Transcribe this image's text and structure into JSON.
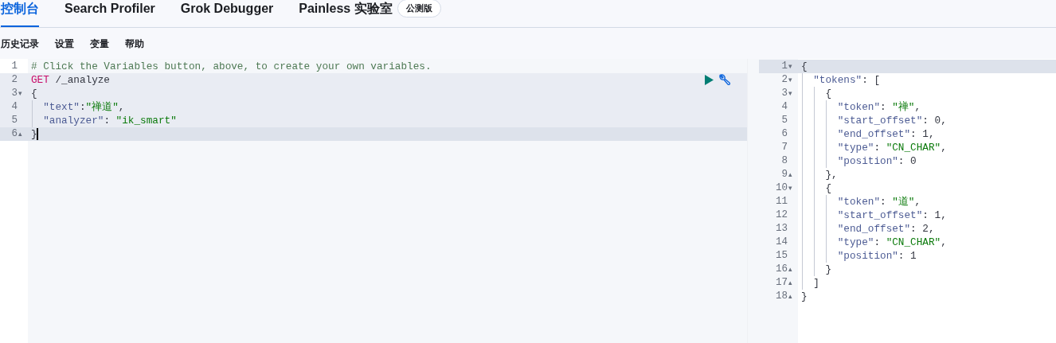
{
  "tabs": [
    {
      "label": "控制台",
      "selected": true
    },
    {
      "label": "Search Profiler",
      "selected": false
    },
    {
      "label": "Grok Debugger",
      "selected": false
    },
    {
      "label": "Painless 实验室",
      "selected": false,
      "badge": "公测版"
    }
  ],
  "toolbar": [
    "历史记录",
    "设置",
    "变量",
    "帮助"
  ],
  "request_editor": {
    "lines": [
      {
        "number": "1",
        "highlighted": false,
        "active": false,
        "segments": [
          {
            "kind": "comment",
            "text": "# Click the Variables button, above, to create your own variables."
          }
        ]
      },
      {
        "number": "2",
        "highlighted": true,
        "active": false,
        "segments": [
          {
            "kind": "method",
            "text": "GET"
          },
          {
            "kind": "plain",
            "text": " /_analyze"
          }
        ]
      },
      {
        "number": "3",
        "fold_marker": "▾",
        "highlighted": true,
        "active": false,
        "segments": [
          {
            "kind": "punct",
            "text": "{"
          }
        ]
      },
      {
        "number": "4",
        "highlighted": true,
        "active": false,
        "segments": [
          {
            "kind": "key",
            "text": "\"text\""
          },
          {
            "kind": "punct",
            "text": ":"
          },
          {
            "kind": "string",
            "text": "\"禅道\""
          },
          {
            "kind": "punct",
            "text": ","
          }
        ]
      },
      {
        "number": "5",
        "highlighted": true,
        "active": false,
        "segments": [
          {
            "kind": "key",
            "text": "\"analyzer\""
          },
          {
            "kind": "punct",
            "text": ": "
          },
          {
            "kind": "string",
            "text": "\"ik_smart\""
          }
        ]
      },
      {
        "number": "6",
        "fold_marker": "▴",
        "highlighted": true,
        "active": true,
        "segments": [
          {
            "kind": "punct",
            "text": "}"
          }
        ]
      }
    ]
  },
  "response_editor": {
    "lines": [
      {
        "number": "1",
        "fold_marker": "▾",
        "active": true,
        "segments": [
          {
            "kind": "punct",
            "text": "{"
          }
        ]
      },
      {
        "number": "2",
        "fold_marker": "▾",
        "active": false,
        "segments": [
          {
            "kind": "key",
            "text": "\"tokens\""
          },
          {
            "kind": "punct",
            "text": ": ["
          }
        ]
      },
      {
        "number": "3",
        "fold_marker": "▾",
        "active": false,
        "segments": [
          {
            "kind": "punct",
            "text": "{"
          }
        ]
      },
      {
        "number": "4",
        "active": false,
        "segments": [
          {
            "kind": "key",
            "text": "\"token\""
          },
          {
            "kind": "punct",
            "text": ": "
          },
          {
            "kind": "string",
            "text": "\"禅\""
          },
          {
            "kind": "punct",
            "text": ","
          }
        ]
      },
      {
        "number": "5",
        "active": false,
        "segments": [
          {
            "kind": "key",
            "text": "\"start_offset\""
          },
          {
            "kind": "punct",
            "text": ": "
          },
          {
            "kind": "number",
            "text": "0"
          },
          {
            "kind": "punct",
            "text": ","
          }
        ]
      },
      {
        "number": "6",
        "active": false,
        "segments": [
          {
            "kind": "key",
            "text": "\"end_offset\""
          },
          {
            "kind": "punct",
            "text": ": "
          },
          {
            "kind": "number",
            "text": "1"
          },
          {
            "kind": "punct",
            "text": ","
          }
        ]
      },
      {
        "number": "7",
        "active": false,
        "segments": [
          {
            "kind": "key",
            "text": "\"type\""
          },
          {
            "kind": "punct",
            "text": ": "
          },
          {
            "kind": "string",
            "text": "\"CN_CHAR\""
          },
          {
            "kind": "punct",
            "text": ","
          }
        ]
      },
      {
        "number": "8",
        "active": false,
        "segments": [
          {
            "kind": "key",
            "text": "\"position\""
          },
          {
            "kind": "punct",
            "text": ": "
          },
          {
            "kind": "number",
            "text": "0"
          }
        ]
      },
      {
        "number": "9",
        "fold_marker": "▴",
        "active": false,
        "segments": [
          {
            "kind": "punct",
            "text": "},"
          }
        ]
      },
      {
        "number": "10",
        "fold_marker": "▾",
        "active": false,
        "segments": [
          {
            "kind": "punct",
            "text": "{"
          }
        ]
      },
      {
        "number": "11",
        "active": false,
        "segments": [
          {
            "kind": "key",
            "text": "\"token\""
          },
          {
            "kind": "punct",
            "text": ": "
          },
          {
            "kind": "string",
            "text": "\"道\""
          },
          {
            "kind": "punct",
            "text": ","
          }
        ]
      },
      {
        "number": "12",
        "active": false,
        "segments": [
          {
            "kind": "key",
            "text": "\"start_offset\""
          },
          {
            "kind": "punct",
            "text": ": "
          },
          {
            "kind": "number",
            "text": "1"
          },
          {
            "kind": "punct",
            "text": ","
          }
        ]
      },
      {
        "number": "13",
        "active": false,
        "segments": [
          {
            "kind": "key",
            "text": "\"end_offset\""
          },
          {
            "kind": "punct",
            "text": ": "
          },
          {
            "kind": "number",
            "text": "2"
          },
          {
            "kind": "punct",
            "text": ","
          }
        ]
      },
      {
        "number": "14",
        "active": false,
        "segments": [
          {
            "kind": "key",
            "text": "\"type\""
          },
          {
            "kind": "punct",
            "text": ": "
          },
          {
            "kind": "string",
            "text": "\"CN_CHAR\""
          },
          {
            "kind": "punct",
            "text": ","
          }
        ]
      },
      {
        "number": "15",
        "active": false,
        "segments": [
          {
            "kind": "key",
            "text": "\"position\""
          },
          {
            "kind": "punct",
            "text": ": "
          },
          {
            "kind": "number",
            "text": "1"
          }
        ]
      },
      {
        "number": "16",
        "fold_marker": "▴",
        "active": false,
        "segments": [
          {
            "kind": "punct",
            "text": "}"
          }
        ]
      },
      {
        "number": "17",
        "fold_marker": "▴",
        "active": false,
        "segments": [
          {
            "kind": "punct",
            "text": "]"
          }
        ]
      },
      {
        "number": "18",
        "fold_marker": "▴",
        "active": false,
        "segments": [
          {
            "kind": "punct",
            "text": "}"
          }
        ]
      }
    ]
  }
}
